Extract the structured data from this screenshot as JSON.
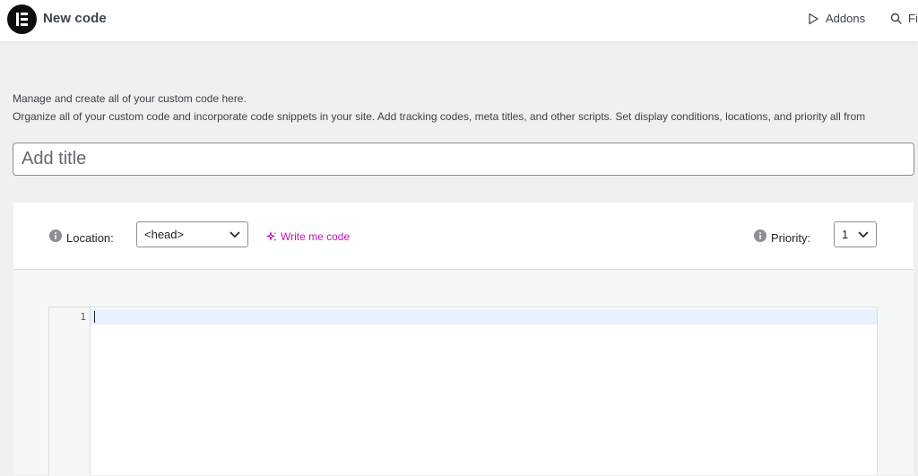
{
  "header": {
    "title": "New code",
    "nav": {
      "addons_label": "Addons",
      "finder_label": "Fi"
    }
  },
  "description": {
    "line1": "Manage and create all of your custom code here.",
    "line2": "Organize all of your custom code and incorporate code snippets in your site. Add tracking codes, meta titles, and other scripts. Set display conditions, locations, and priority all from"
  },
  "title_field": {
    "placeholder": "Add title",
    "value": ""
  },
  "code_settings": {
    "location": {
      "label": "Location:",
      "selected": "<head>"
    },
    "ai_link_label": "Write me code",
    "priority": {
      "label": "Priority:",
      "selected": "1"
    }
  },
  "editor": {
    "line_numbers": [
      "1"
    ],
    "content": ""
  },
  "colors": {
    "accent_ai": "#c00fbf",
    "logo_bg": "#0c0d0e",
    "active_line": "#e8f2ff"
  },
  "icons": {
    "logo": "elementor-logo-icon",
    "addons": "play-triangle-icon",
    "finder": "search-icon",
    "info": "info-icon",
    "dropdown": "chevron-down-icon",
    "ai": "sparkle-icon"
  }
}
